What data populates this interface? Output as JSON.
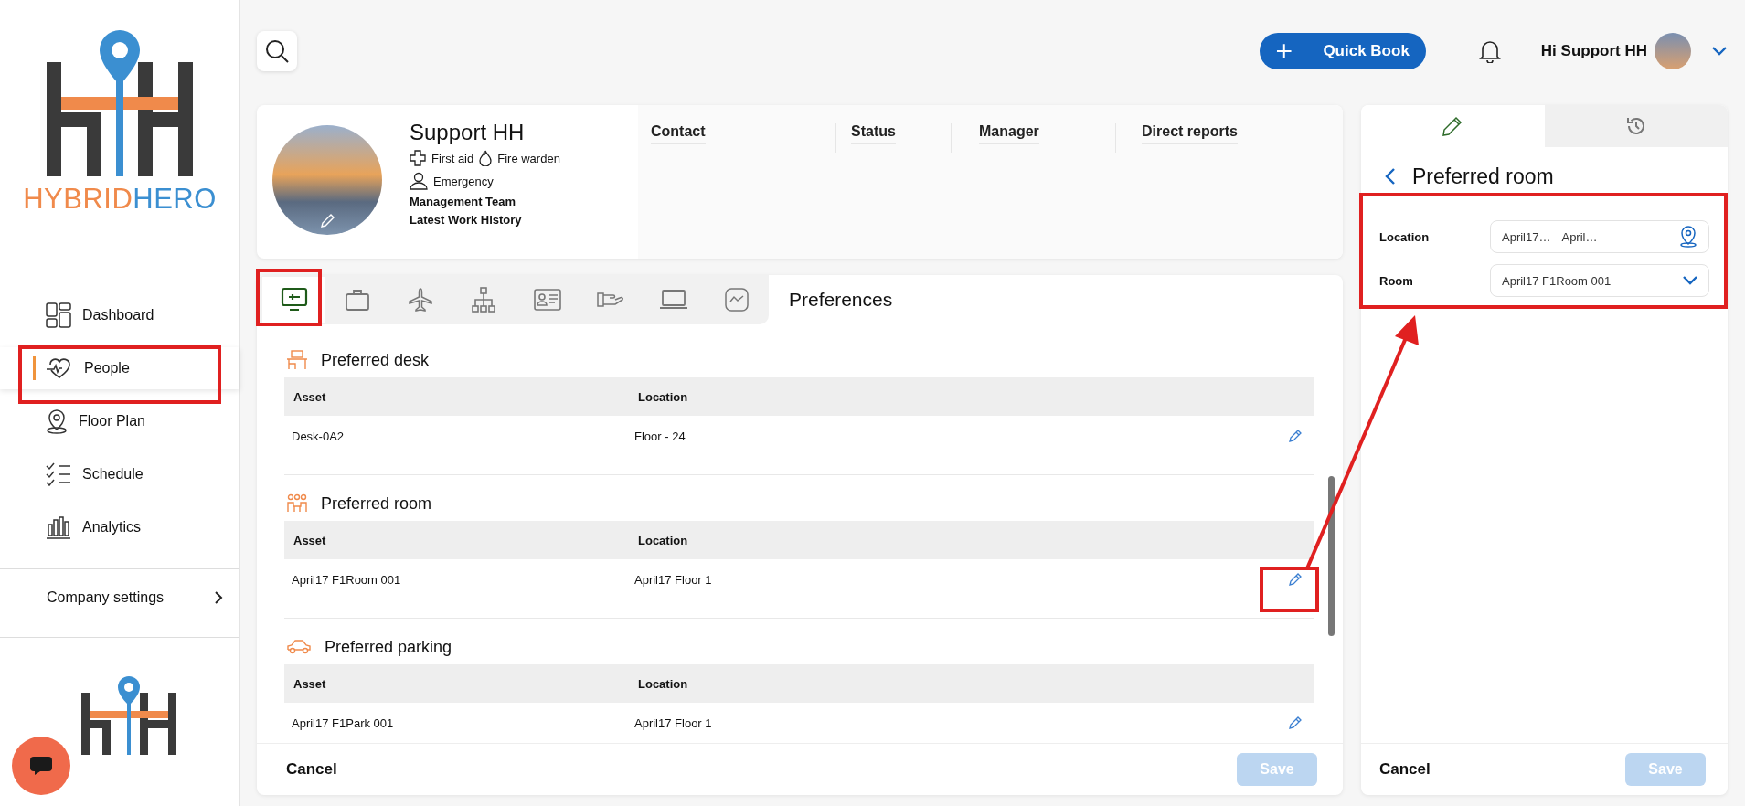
{
  "logo": {
    "word_1": "HYBRID",
    "word_2": "HERO"
  },
  "nav": {
    "items": [
      {
        "label": "Dashboard",
        "kind": "grid",
        "selected": false
      },
      {
        "label": "People",
        "kind": "heart",
        "selected": true
      },
      {
        "label": "Floor Plan",
        "kind": "pin",
        "selected": false
      },
      {
        "label": "Schedule",
        "kind": "checklist",
        "selected": false
      },
      {
        "label": "Analytics",
        "kind": "bars",
        "selected": false
      }
    ]
  },
  "company_settings": {
    "label": "Company settings"
  },
  "topbar": {
    "quick_book": "Quick Book",
    "greeting": "Hi Support HH"
  },
  "profile": {
    "name": "Support HH",
    "badges": [
      {
        "label": "First aid",
        "kind": "cross"
      },
      {
        "label": "Fire warden",
        "kind": "flame"
      },
      {
        "label": "Emergency",
        "kind": "person"
      }
    ],
    "team": "Management Team",
    "history": "Latest Work History",
    "columns": [
      "Contact",
      "Status",
      "Manager",
      "Direct reports"
    ]
  },
  "tabs": [
    {
      "kind": "desk",
      "selected": true
    },
    {
      "kind": "briefcase",
      "selected": false
    },
    {
      "kind": "plane",
      "selected": false
    },
    {
      "kind": "hierarchy",
      "selected": false
    },
    {
      "kind": "idcard",
      "selected": false
    },
    {
      "kind": "hand",
      "selected": false
    },
    {
      "kind": "laptop",
      "selected": false
    },
    {
      "kind": "chart",
      "selected": false
    }
  ],
  "tabs_title": "Preferences",
  "sections": [
    {
      "title": "Preferred desk",
      "kind": "desk",
      "columns": [
        "Asset",
        "Location"
      ],
      "rows": [
        {
          "asset": "Desk-0A2",
          "location": "Floor - 24"
        }
      ]
    },
    {
      "title": "Preferred room",
      "kind": "people",
      "columns": [
        "Asset",
        "Location"
      ],
      "rows": [
        {
          "asset": "April17 F1Room 001",
          "location": "April17 Floor 1"
        }
      ]
    },
    {
      "title": "Preferred parking",
      "kind": "car",
      "columns": [
        "Asset",
        "Location"
      ],
      "rows": [
        {
          "asset": "April17 F1Park 001",
          "location": "April17 Floor 1"
        }
      ]
    }
  ],
  "footer": {
    "cancel": "Cancel",
    "save": "Save",
    "save_disabled": true
  },
  "panel": {
    "tabs": [
      {
        "kind": "pencil",
        "selected": true
      },
      {
        "kind": "history",
        "selected": false
      }
    ],
    "title": "Preferred room",
    "fields": [
      {
        "label": "Location",
        "kind": "location",
        "value_1": "April17…",
        "value_2": "April…"
      },
      {
        "label": "Room",
        "kind": "select",
        "value": "April17 F1Room 001"
      }
    ],
    "cancel": "Cancel",
    "save": "Save",
    "save_disabled": true
  }
}
